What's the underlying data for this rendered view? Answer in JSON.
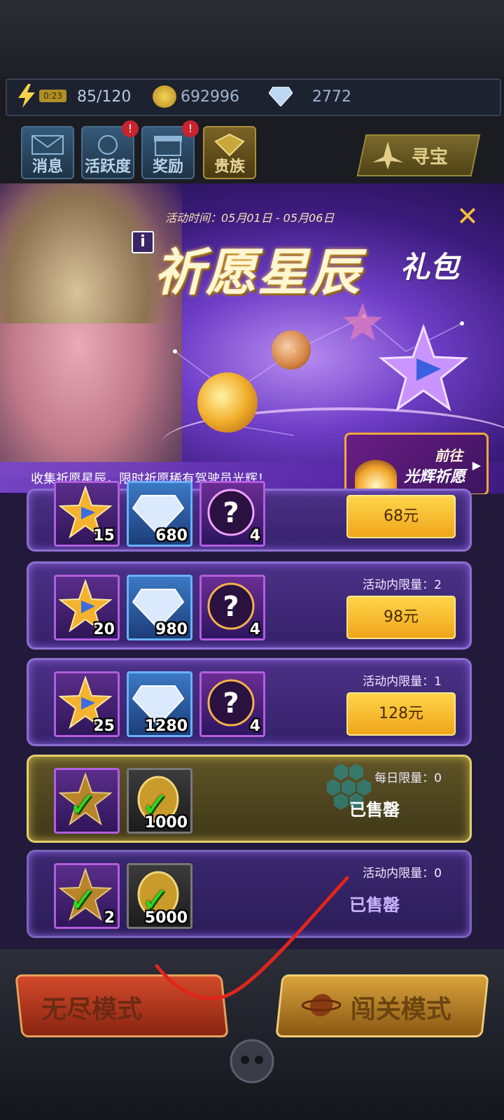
{
  "resources": {
    "timer": "0:23",
    "energy": "85/120",
    "coins": "692996",
    "gems": "2772"
  },
  "top_buttons": [
    {
      "label": "消息",
      "badge": ""
    },
    {
      "label": "活跃度",
      "badge": "!"
    },
    {
      "label": "奖励",
      "badge": "!"
    },
    {
      "label": "贵族",
      "badge": ""
    }
  ],
  "treasure_label": "寻宝",
  "banner": {
    "activity_time": "活动时间：05月01日 - 05月06日",
    "title": "祈愿星辰",
    "title_suffix": "礼包",
    "subtitle": "收集祈愿星辰，限时祈愿稀有驾驶员光辉！",
    "goto_line1": "前往",
    "goto_line2": "光辉祈愿",
    "close_icon": "close-icon",
    "info_icon": "info-icon"
  },
  "packs": [
    {
      "star": "15",
      "gems": "680",
      "mystery": "4",
      "limit": "",
      "price": "68元",
      "sold": ""
    },
    {
      "star": "20",
      "gems": "980",
      "mystery": "4",
      "limit": "活动内限量：2",
      "price": "98元",
      "sold": ""
    },
    {
      "star": "25",
      "gems": "1280",
      "mystery": "4",
      "limit": "活动内限量：1",
      "price": "128元",
      "sold": ""
    },
    {
      "star": "",
      "coins": "1000",
      "limit": "每日限量：0",
      "price": "",
      "sold": "已售罄"
    },
    {
      "star": "2",
      "coins": "5000",
      "limit": "活动内限量：0",
      "price": "",
      "sold": "已售罄"
    }
  ],
  "bottom": {
    "endless_mode": "无尽模式",
    "stage_mode": "闯关模式"
  },
  "colors": {
    "accent_gold": "#f0a51b",
    "sold_purple": "#c9b3ff",
    "sold_gold": "#ffffff",
    "scribble_red": "#e0251c"
  }
}
